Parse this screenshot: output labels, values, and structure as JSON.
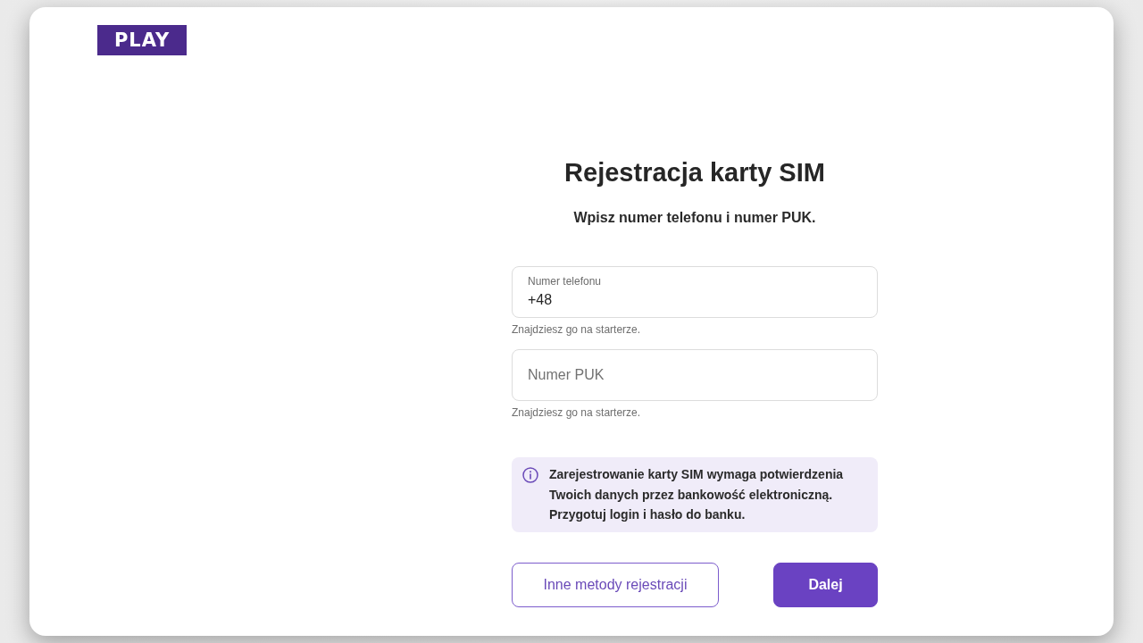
{
  "logo": {
    "text": "PLAY"
  },
  "title": "Rejestracja karty SIM",
  "subtitle": "Wpisz numer telefonu i numer PUK.",
  "fields": [
    {
      "label": "Numer telefonu",
      "value": "+48",
      "hint": "Znajdziesz go na starterze."
    },
    {
      "placeholder": "Numer PUK",
      "hint": "Znajdziesz go na starterze."
    }
  ],
  "info": {
    "text": "Zarejestrowanie karty SIM wymaga potwierdzenia Twoich danych przez bankowość elektroniczną. Przygotuj login i hasło do banku."
  },
  "buttons": [
    {
      "label": "Inne metody rejestracji",
      "kind": "secondary"
    },
    {
      "label": "Dalej",
      "kind": "primary"
    }
  ]
}
